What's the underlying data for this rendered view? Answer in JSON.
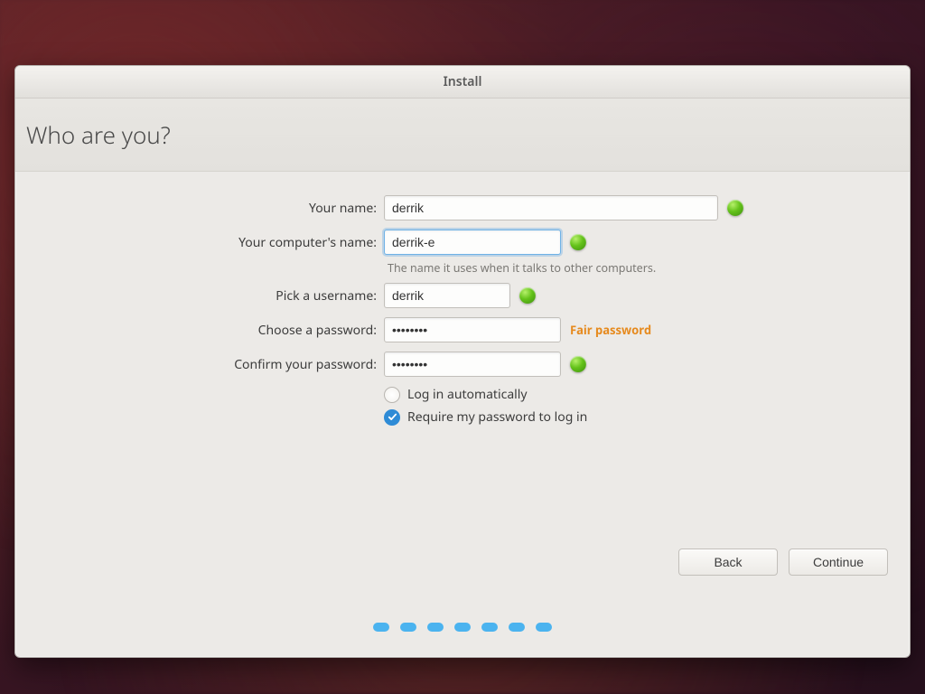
{
  "window": {
    "title": "Install"
  },
  "page": {
    "heading": "Who are you?"
  },
  "labels": {
    "name": "Your name:",
    "host": "Your computer's name:",
    "hosthint": "The name it uses when it talks to other computers.",
    "user": "Pick a username:",
    "pass": "Choose a password:",
    "confirm": "Confirm your password:"
  },
  "values": {
    "name": "derrik",
    "host": "derrik-e",
    "user": "derrik",
    "pass": "••••••••",
    "confirm": "••••••••"
  },
  "strength": {
    "label": "Fair password",
    "color": "#e68a1e"
  },
  "login_options": {
    "auto": "Log in automatically",
    "require": "Require my password to log in",
    "selected": "require"
  },
  "buttons": {
    "back": "Back",
    "continue": "Continue"
  },
  "progress": {
    "total": 7
  }
}
